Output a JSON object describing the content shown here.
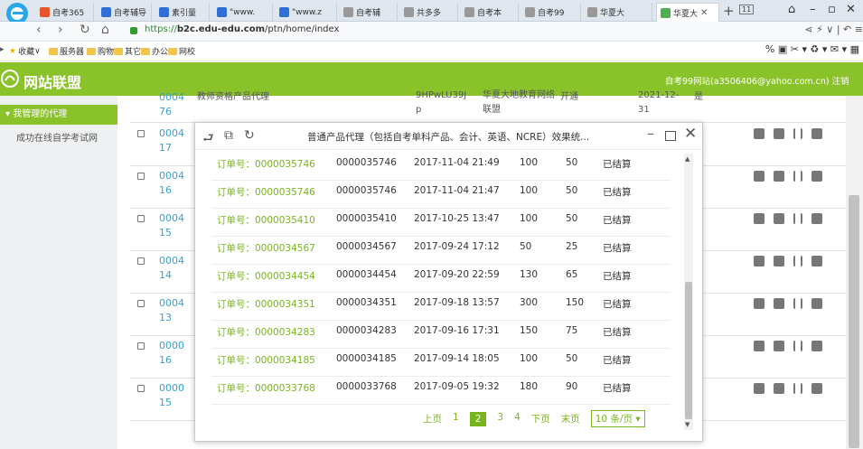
{
  "browser": {
    "tabs": [
      {
        "label": "自考365",
        "color": "#e8552b"
      },
      {
        "label": "自考辅导",
        "color": "#2f6fd6"
      },
      {
        "label": "素引量",
        "color": "#2f6fd6"
      },
      {
        "label": "\"www.",
        "color": "#2f6fd6"
      },
      {
        "label": "\"www.z",
        "color": "#2f6fd6"
      },
      {
        "label": "自考辅",
        "color": "#999999"
      },
      {
        "label": "共多多",
        "color": "#999999"
      },
      {
        "label": "自考本",
        "color": "#999999"
      },
      {
        "label": "自考99",
        "color": "#999999"
      },
      {
        "label": "华夏大",
        "color": "#999999"
      },
      {
        "label": "华夏大",
        "color": "#4caf50"
      }
    ],
    "tab_count": "11",
    "url_scheme": "https://",
    "url_host": "b2c.edu-edu.com",
    "url_path": "/ptn/home/index"
  },
  "bookmarks": [
    {
      "label": "收藏"
    },
    {
      "label": "服务器"
    },
    {
      "label": "购物"
    },
    {
      "label": "其它"
    },
    {
      "label": "办公"
    },
    {
      "label": "网校"
    }
  ],
  "site": {
    "title": "网站联盟",
    "user": "自考99网站(a3506406@yahoo.com.cn)  注销",
    "brand_color": "#8ac22a"
  },
  "sidebar": {
    "group": "我管理的代理",
    "item": "成功在线自学考试网"
  },
  "table": {
    "top_row": {
      "id": "0004\n76",
      "desc": "教师资格产品代理",
      "code": "9HPwLU39J\np",
      "org": "华夏大地教育网络\n联盟",
      "status": "开通",
      "date": "2021-12-\n31",
      "flag": "是"
    },
    "rows": [
      "0004\n17",
      "0004\n16",
      "0004\n15",
      "0004\n14",
      "0004\n13",
      "0000\n16",
      "0000\n15"
    ]
  },
  "modal": {
    "title": "普通产品代理（包括自考单科产品、会计、英语、NCRE）效果统...",
    "records": [
      {
        "order": "订单号：0000035746",
        "id": "0000035746",
        "time": "2017-11-04 21:49",
        "amount": "100",
        "commission": "50",
        "status": "已结算"
      },
      {
        "order": "订单号：0000035746",
        "id": "0000035746",
        "time": "2017-11-04 21:47",
        "amount": "100",
        "commission": "50",
        "status": "已结算"
      },
      {
        "order": "订单号：0000035410",
        "id": "0000035410",
        "time": "2017-10-25 13:47",
        "amount": "100",
        "commission": "50",
        "status": "已结算"
      },
      {
        "order": "订单号：0000034567",
        "id": "0000034567",
        "time": "2017-09-24 17:12",
        "amount": "50",
        "commission": "25",
        "status": "已结算"
      },
      {
        "order": "订单号：0000034454",
        "id": "0000034454",
        "time": "2017-09-20 22:59",
        "amount": "130",
        "commission": "65",
        "status": "已结算"
      },
      {
        "order": "订单号：0000034351",
        "id": "0000034351",
        "time": "2017-09-18 13:57",
        "amount": "300",
        "commission": "150",
        "status": "已结算"
      },
      {
        "order": "订单号：0000034283",
        "id": "0000034283",
        "time": "2017-09-16 17:31",
        "amount": "150",
        "commission": "75",
        "status": "已结算"
      },
      {
        "order": "订单号：0000034185",
        "id": "0000034185",
        "time": "2017-09-14 18:05",
        "amount": "100",
        "commission": "50",
        "status": "已结算"
      },
      {
        "order": "订单号：0000033768",
        "id": "0000033768",
        "time": "2017-09-05 19:32",
        "amount": "180",
        "commission": "90",
        "status": "已结算"
      }
    ],
    "pager": {
      "prev": "上页",
      "pages": [
        "1",
        "2",
        "3",
        "4"
      ],
      "current": "2",
      "next": "下页",
      "last": "末页",
      "size": "10 条/页"
    }
  }
}
